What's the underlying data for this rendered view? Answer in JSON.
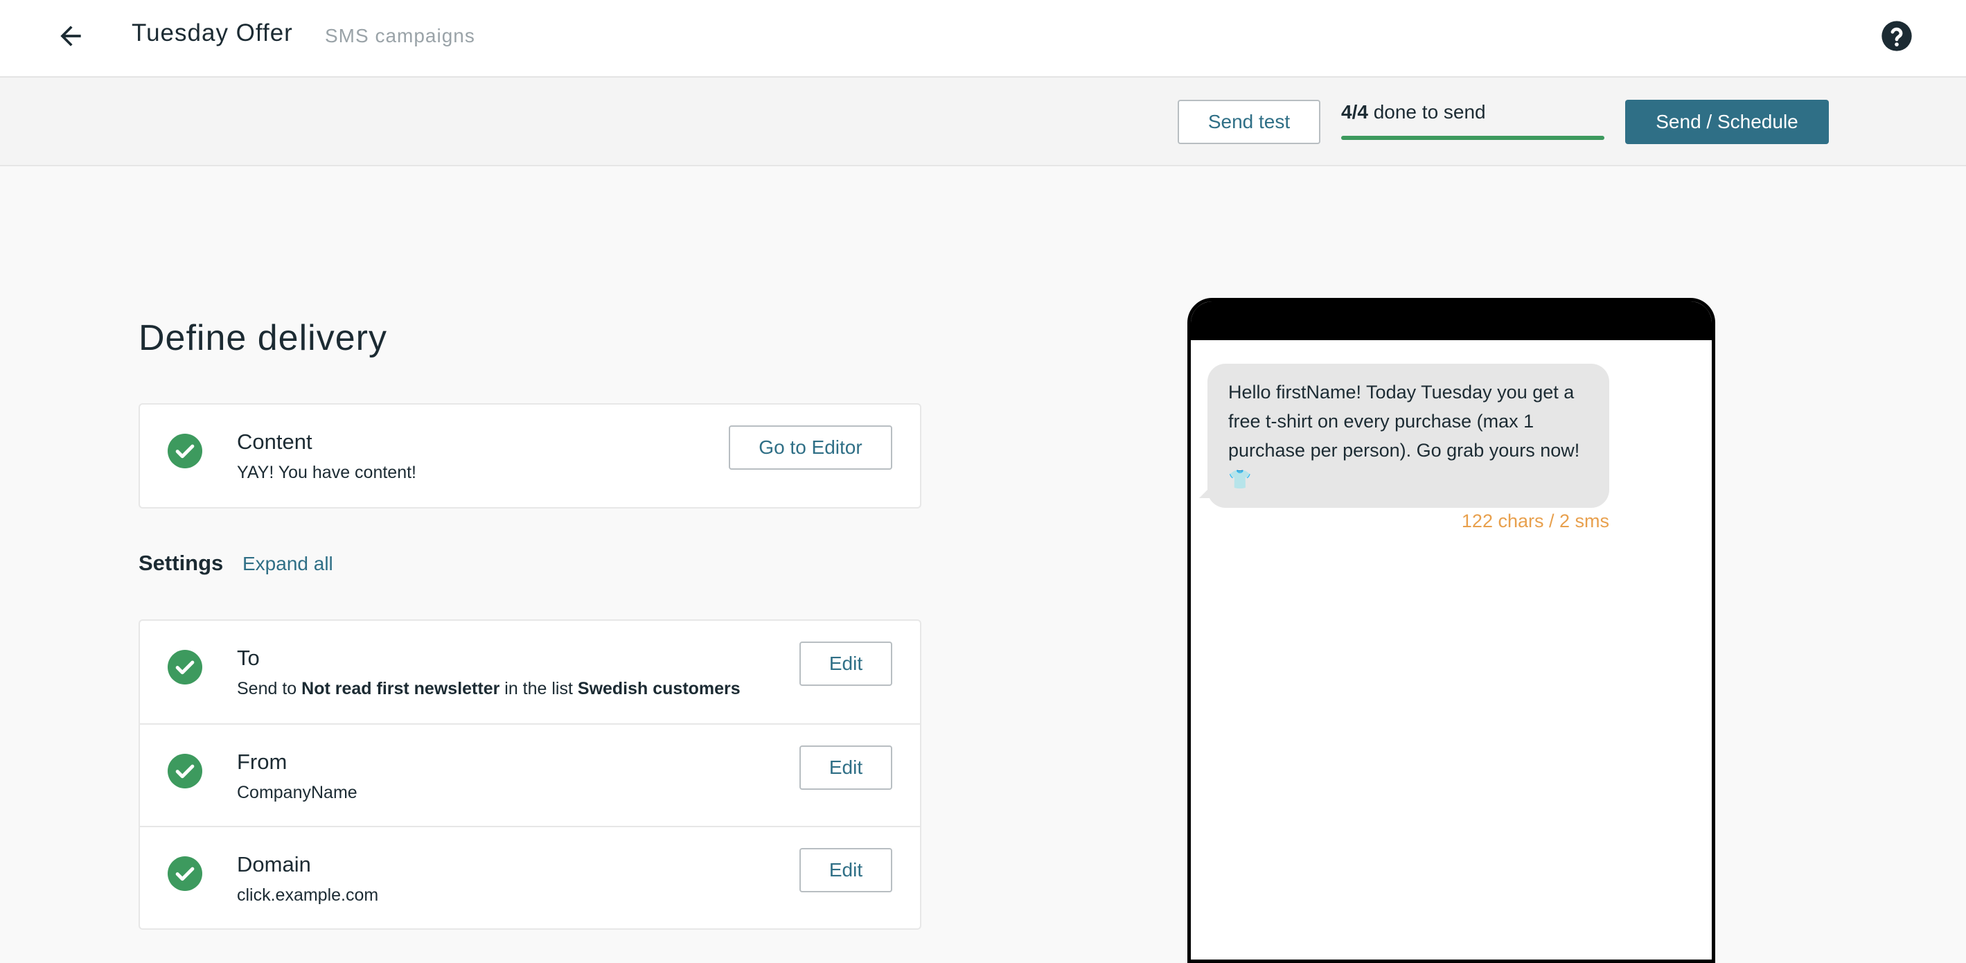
{
  "header": {
    "title": "Tuesday Offer",
    "subtitle": "SMS campaigns"
  },
  "actionbar": {
    "send_test_label": "Send test",
    "progress_count": "4/4",
    "progress_text": " done to send",
    "progress_fraction": 1.0,
    "primary_label": "Send / Schedule"
  },
  "main": {
    "heading": "Define delivery",
    "content_card": {
      "title": "Content",
      "desc": "YAY! You have content!",
      "button": "Go to Editor"
    },
    "settings": {
      "label": "Settings",
      "expand_label": "Expand all",
      "rows": [
        {
          "title": "To",
          "desc_prefix": "Send to ",
          "desc_bold1": "Not read first newsletter",
          "desc_mid": " in the list ",
          "desc_bold2": "Swedish customers",
          "button": "Edit"
        },
        {
          "title": "From",
          "desc": "CompanyName",
          "button": "Edit"
        },
        {
          "title": "Domain",
          "desc": "click.example.com",
          "button": "Edit"
        }
      ]
    }
  },
  "preview": {
    "message": "Hello firstName! Today Tuesday you get a free t-shirt on every purchase (max 1 purchase per person). Go grab yours now! 👕",
    "char_count": "122 chars / 2 sms"
  },
  "colors": {
    "accent": "#2f6f86",
    "success": "#3d9a5e",
    "warning_text": "#e8a04d"
  },
  "icons": [
    "arrow-left-icon",
    "help-circle-icon",
    "check-circle-icon",
    "tshirt-emoji"
  ]
}
